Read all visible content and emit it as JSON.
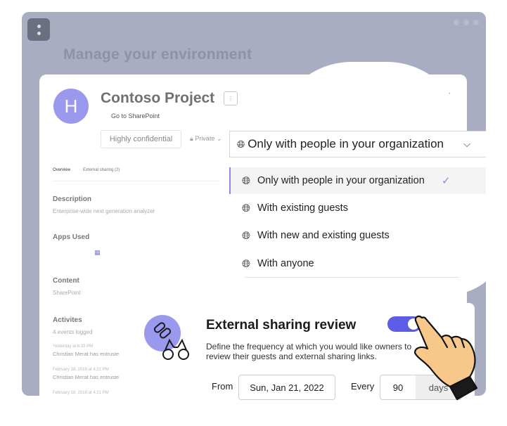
{
  "background": {
    "title": "Manage your environment"
  },
  "project": {
    "avatar_letter": "H",
    "title": "Contoso Project",
    "more_icon": "more-icon",
    "sharepoint_link": "Go to SharePoint",
    "sensitivity_badge": "Highly confidential",
    "privacy": "Private",
    "tabs": [
      {
        "label": "Overview"
      },
      {
        "label": "External sharing (2)"
      }
    ],
    "description_heading": "Description",
    "description_text": "Enterprise-wide next generation analyzer",
    "apps_heading": "Apps Used",
    "content_heading": "Content",
    "content_text": "SharePoint",
    "activities_heading": "Activites",
    "activities_count": "4 events logged",
    "activities": [
      {
        "time": "Yesterday at 6:33 PM",
        "text": "Christian Merat has entruste"
      },
      {
        "time": "February 18, 2019 at 4:21 PM",
        "text": "Christian Merat has entruste"
      },
      {
        "time": "February 18, 2019 at 4:21 PM",
        "text": ""
      }
    ]
  },
  "sharing": {
    "selected_value": "Only with people in your organization",
    "options": [
      {
        "label": "Only with people in your organization",
        "icon": "globe-org-icon",
        "selected": true
      },
      {
        "label": "With existing guests",
        "icon": "globe-existing-icon",
        "selected": false
      },
      {
        "label": "With new and existing guests",
        "icon": "globe-new-icon",
        "selected": false
      },
      {
        "label": "With anyone",
        "icon": "globe-icon",
        "selected": false
      }
    ]
  },
  "review": {
    "title": "External sharing review",
    "enabled": true,
    "description": "Define the frequency at which you would like owners to review their guests and external sharing links.",
    "from_label": "From",
    "from_date": "Sun, Jan 21, 2022",
    "every_label": "Every",
    "interval_value": "90",
    "interval_unit": "days"
  },
  "colors": {
    "accent": "#5c5ce6",
    "avatar": "#9b99ee",
    "frame": "#a8adc2",
    "hand_skin": "#f7c88a"
  }
}
